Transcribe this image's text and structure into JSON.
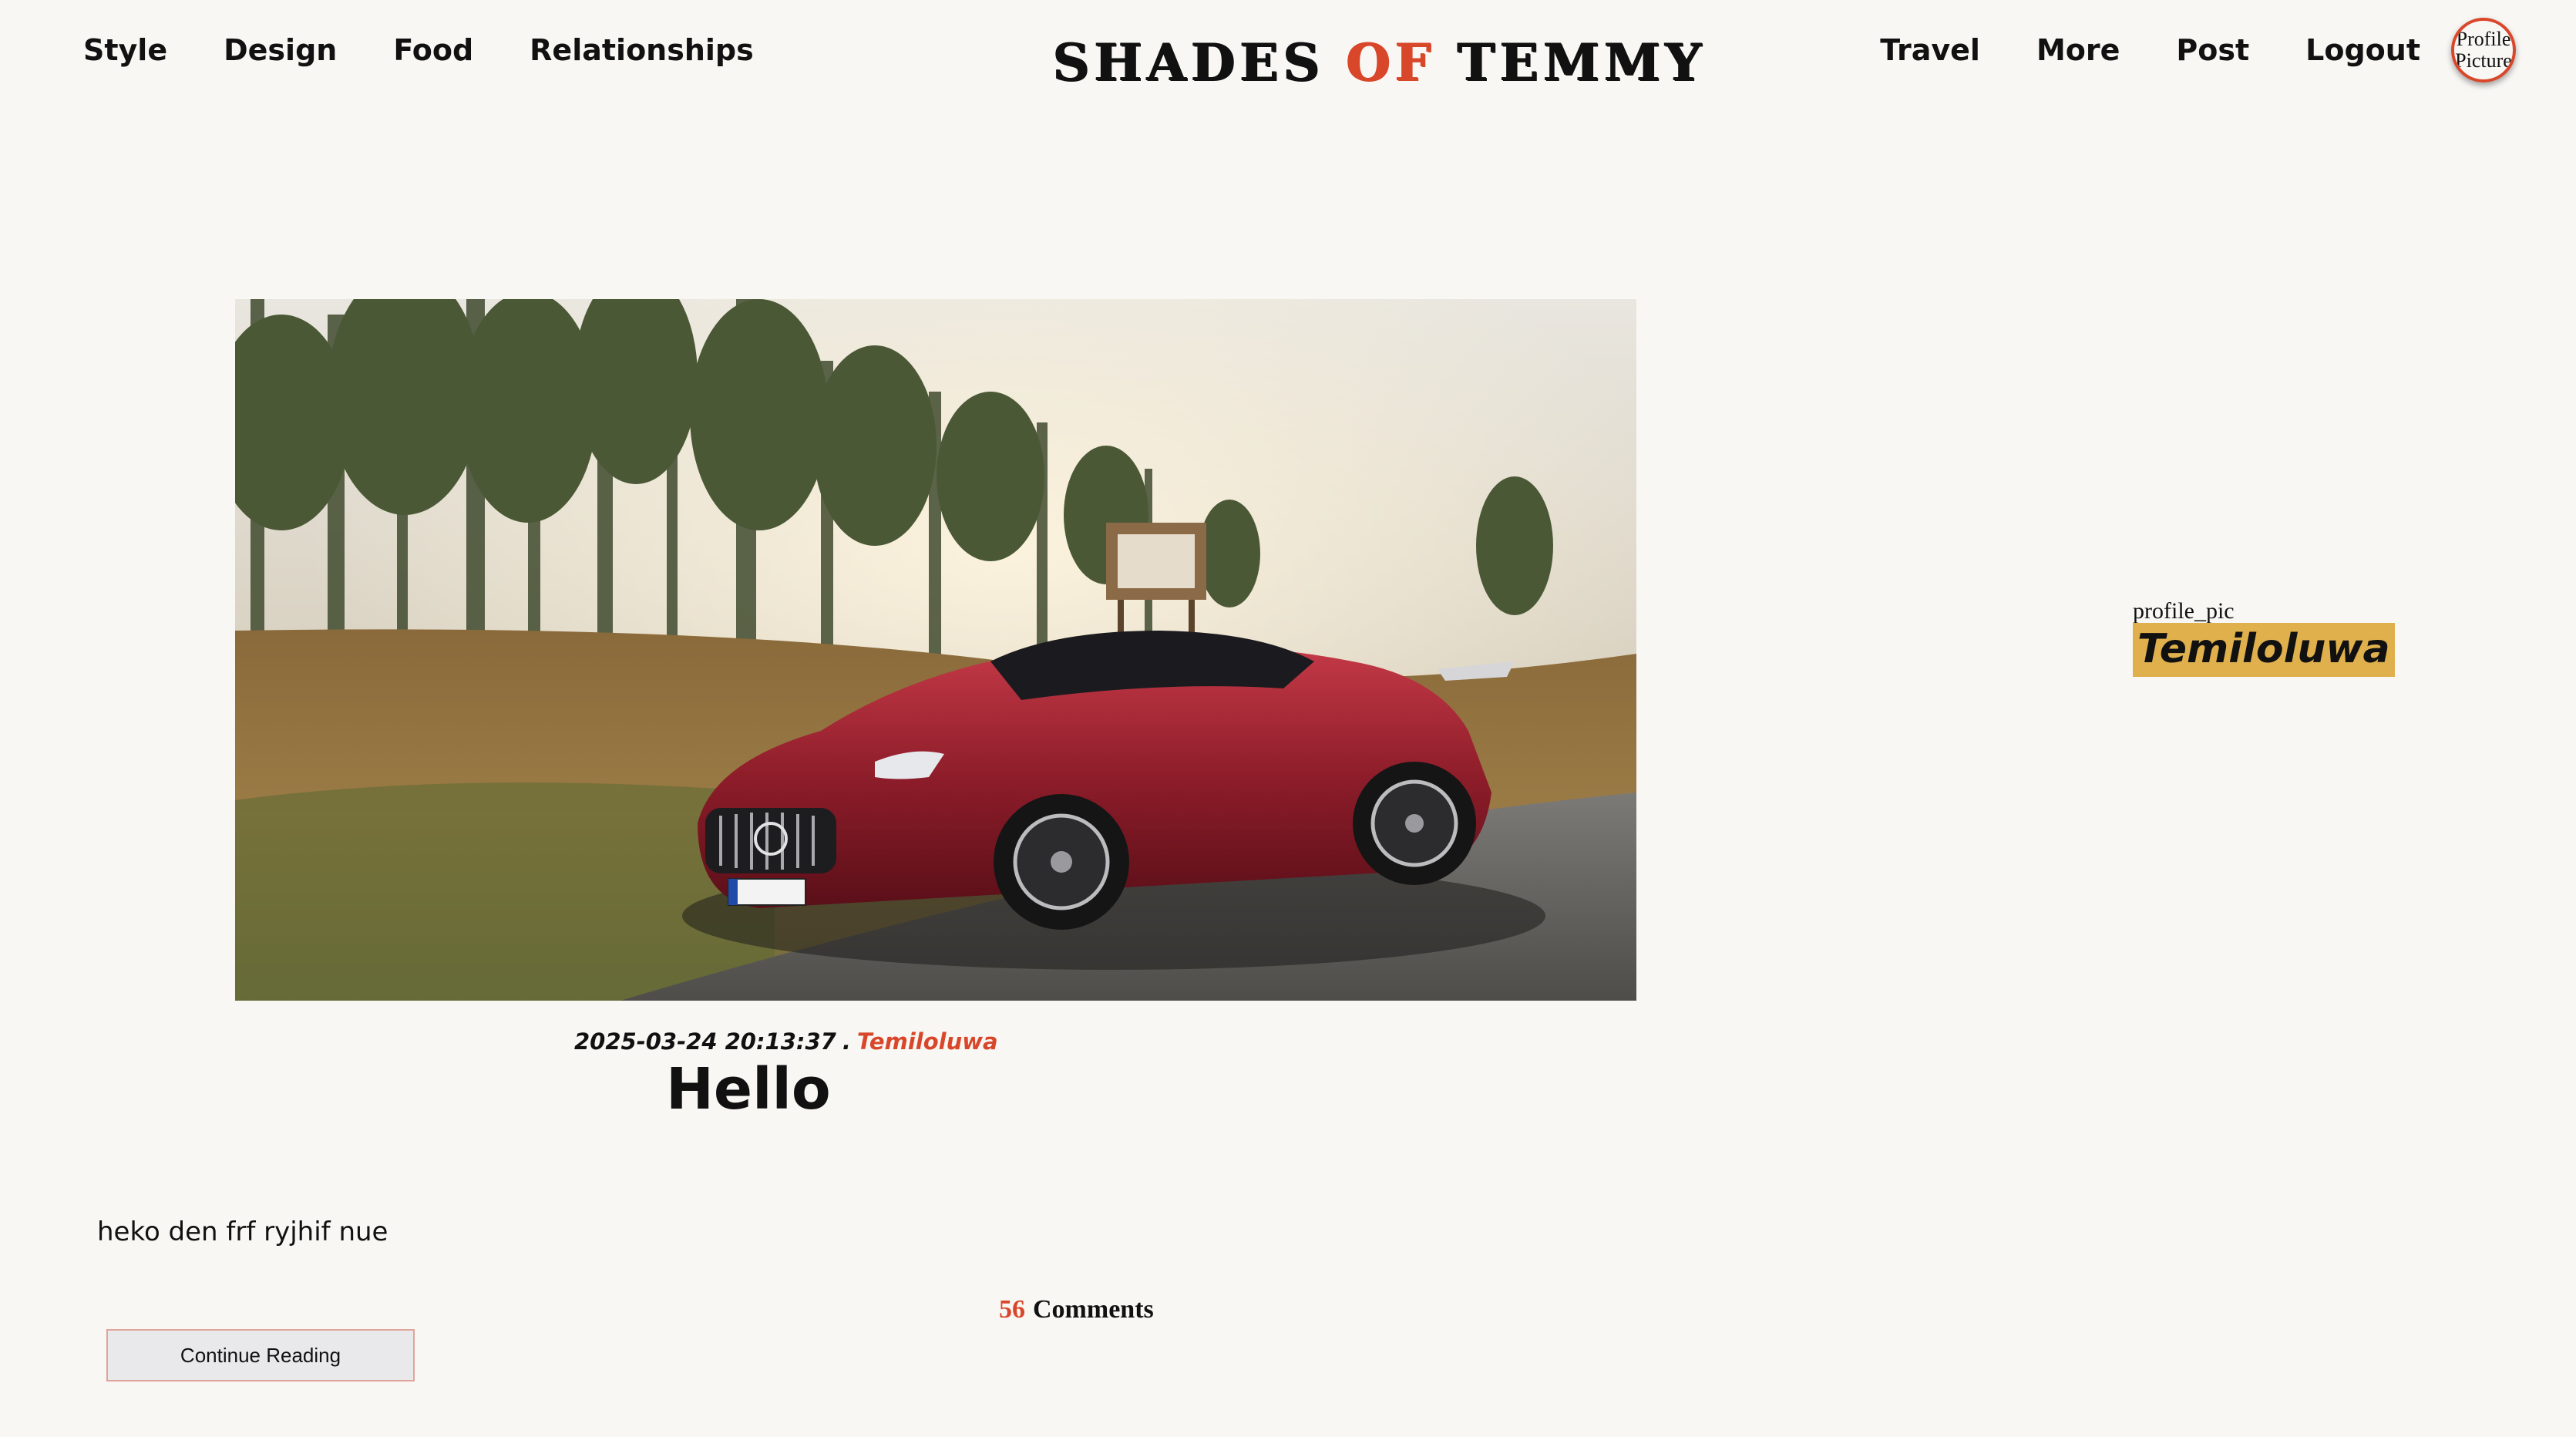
{
  "header": {
    "nav_left": [
      "Style",
      "Design",
      "Food",
      "Relationships"
    ],
    "brand": {
      "part1": "SHADES",
      "part2": "OF",
      "part3": "TEMMY"
    },
    "nav_right": [
      "Travel",
      "More",
      "Post",
      "Logout"
    ],
    "profile_picture_alt": "Profile Picture"
  },
  "post": {
    "image_icon": "car-photo",
    "date": "2025-03-24 20:13:37",
    "separator": ".",
    "author": "Temiloluwa",
    "title": "Hello",
    "excerpt": "heko den frf ryjhif nue",
    "comments_count": "56",
    "comments_label": "Comments",
    "continue_label": "Continue Reading"
  },
  "sidebar": {
    "profile_pic_alt": "profile_pic",
    "author_name": "Temiloluwa"
  },
  "colors": {
    "background": "#f8f7f4",
    "accent": "#d9472b",
    "author_badge": "#e0b04d",
    "button_bg": "#e9e9eb",
    "button_border": "#e0a59a"
  }
}
